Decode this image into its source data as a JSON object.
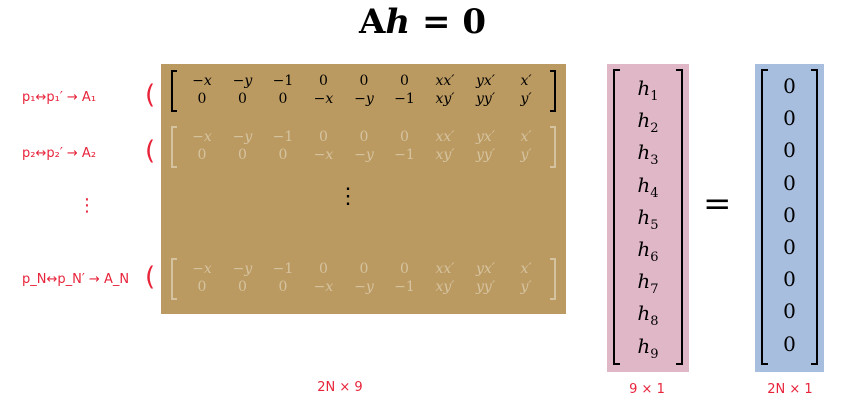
{
  "title": {
    "A": "A",
    "h": "h",
    "eq": "=",
    "zero": "0"
  },
  "notes": {
    "row1": "p₁↔p₁′ → A₁",
    "row2": "p₂↔p₂′ → A₂",
    "rowN": "p_N↔p_N′ → A_N",
    "paren": "(",
    "vdots": "⋮"
  },
  "matrix_A": {
    "row_top": [
      "−x",
      "−y",
      "−1",
      "0",
      "0",
      "0",
      "xx′",
      "yx′",
      "x′"
    ],
    "row_bottom": [
      "0",
      "0",
      "0",
      "−x",
      "−y",
      "−1",
      "xy′",
      "yy′",
      "y′"
    ],
    "vdots": "⋮",
    "fill_color": "#bb9a61"
  },
  "vector_h": {
    "symbol": "h",
    "indices": [
      "1",
      "2",
      "3",
      "4",
      "5",
      "6",
      "7",
      "8",
      "9"
    ],
    "fill_color": "#dfb7c6"
  },
  "equals": "=",
  "vector_zero": {
    "values": [
      "0",
      "0",
      "0",
      "0",
      "0",
      "0",
      "0",
      "0",
      "0"
    ],
    "fill_color": "#a8bede"
  },
  "dimensions": {
    "A": "2N × 9",
    "h": "9 × 1",
    "zero": "2N × 1"
  }
}
